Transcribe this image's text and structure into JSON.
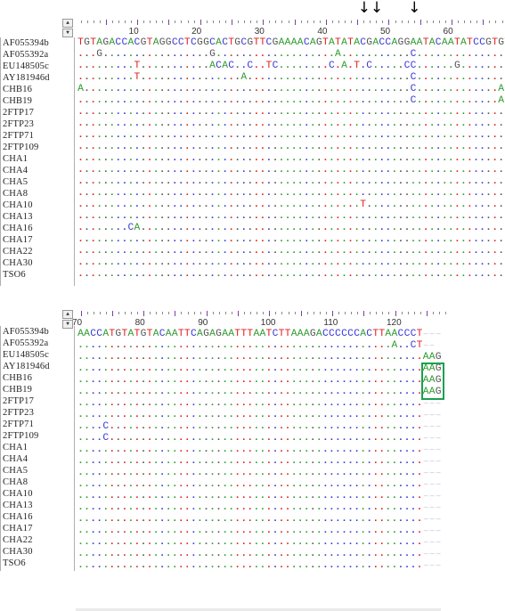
{
  "block1": {
    "ruler_start": 1,
    "ruler_labels": [
      10,
      20,
      30,
      40,
      50,
      60
    ],
    "arrows": [
      46,
      48,
      54
    ],
    "reference": "TGTAGACCACGTAGGCCTCGGCACTGCGTTCGAAAACAGTATATACGACCAGGAATACAATATCCGTGT",
    "rows": [
      {
        "name": "AF055394b",
        "seq": "TGTAGACCACGTAGGCCTCGGCACTGCGTTCGAAAACAGTATATACGACCAGGAATACAATATCCGTGT"
      },
      {
        "name": "AF055392a",
        "seq": "...G.................G...................A...........C..............."
      },
      {
        "name": "EU148505c",
        "seq": ".........T...........ACAC..C..TC........C.A.T.C.....CC......G........"
      },
      {
        "name": "AY181946d",
        "seq": ".........T................A..........................C..............."
      },
      {
        "name": "CHB16",
        "seq": "A....................................................C.............A."
      },
      {
        "name": "CHB19",
        "seq": ".....................................................C.............A."
      },
      {
        "name": "2FTP17",
        "seq": "....................................................................."
      },
      {
        "name": "2FTP23",
        "seq": "....................................................................."
      },
      {
        "name": "2FTP71",
        "seq": "....................................................................."
      },
      {
        "name": "2FTP109",
        "seq": "....................................................................."
      },
      {
        "name": "CHA1",
        "seq": "....................................................................."
      },
      {
        "name": "CHA4",
        "seq": "....................................................................."
      },
      {
        "name": "CHA5",
        "seq": "....................................................................."
      },
      {
        "name": "CHA8",
        "seq": "....................................................................."
      },
      {
        "name": "CHA10",
        "seq": ".............................................T......................."
      },
      {
        "name": "CHA13",
        "seq": "....................................................................."
      },
      {
        "name": "CHA16",
        "seq": "........CA..........................................................."
      },
      {
        "name": "CHA17",
        "seq": "....................................................................."
      },
      {
        "name": "CHA22",
        "seq": "....................................................................."
      },
      {
        "name": "CHA30",
        "seq": "....................................................................."
      },
      {
        "name": "TSO6",
        "seq": "....................................................................."
      }
    ]
  },
  "block2": {
    "ruler_start": 70,
    "ruler_labels": [
      70,
      80,
      90,
      100,
      110,
      120
    ],
    "highlight": {
      "rows": [
        "AY181946d",
        "CHB16",
        "CHB19"
      ],
      "value": "AAG",
      "color": "#1aa050"
    },
    "rows": [
      {
        "name": "AF055394b",
        "seq": "AACCATGTATGTACAATTCAGAGAATTTAATCTTAAAGACCCCCCACTTAACCCT---"
      },
      {
        "name": "AF055392a",
        "seq": "..................................................A..CT--"
      },
      {
        "name": "EU148505c",
        "seq": ".......................................................AAG"
      },
      {
        "name": "AY181946d",
        "seq": ".......................................................AAG"
      },
      {
        "name": "CHB16",
        "seq": ".......................................................AAG"
      },
      {
        "name": "CHB19",
        "seq": ".......................................................AAG"
      },
      {
        "name": "2FTP17",
        "seq": ".......................................................---"
      },
      {
        "name": "2FTP23",
        "seq": ".......................................................---"
      },
      {
        "name": "2FTP71",
        "seq": "....C..................................................---"
      },
      {
        "name": "2FTP109",
        "seq": "....C..................................................---"
      },
      {
        "name": "CHA1",
        "seq": ".......................................................---"
      },
      {
        "name": "CHA4",
        "seq": ".......................................................---"
      },
      {
        "name": "CHA5",
        "seq": ".......................................................---"
      },
      {
        "name": "CHA8",
        "seq": ".......................................................---"
      },
      {
        "name": "CHA10",
        "seq": ".......................................................---"
      },
      {
        "name": "CHA13",
        "seq": ".......................................................---"
      },
      {
        "name": "CHA16",
        "seq": ".......................................................---"
      },
      {
        "name": "CHA17",
        "seq": ".......................................................---"
      },
      {
        "name": "CHA22",
        "seq": ".......................................................---"
      },
      {
        "name": "CHA30",
        "seq": ".......................................................---"
      },
      {
        "name": "TSO6",
        "seq": ".......................................................---"
      }
    ]
  },
  "scroll": {
    "up_icon": "▲",
    "down_icon": "▼"
  },
  "arrow_glyph": "↓",
  "colors": {
    "A": "#2e9c2e",
    "C": "#3a3ad8",
    "G": "#555555",
    "T": "#e02020",
    "gap": "#b9b9d6",
    "highlight": "#1aa050"
  }
}
